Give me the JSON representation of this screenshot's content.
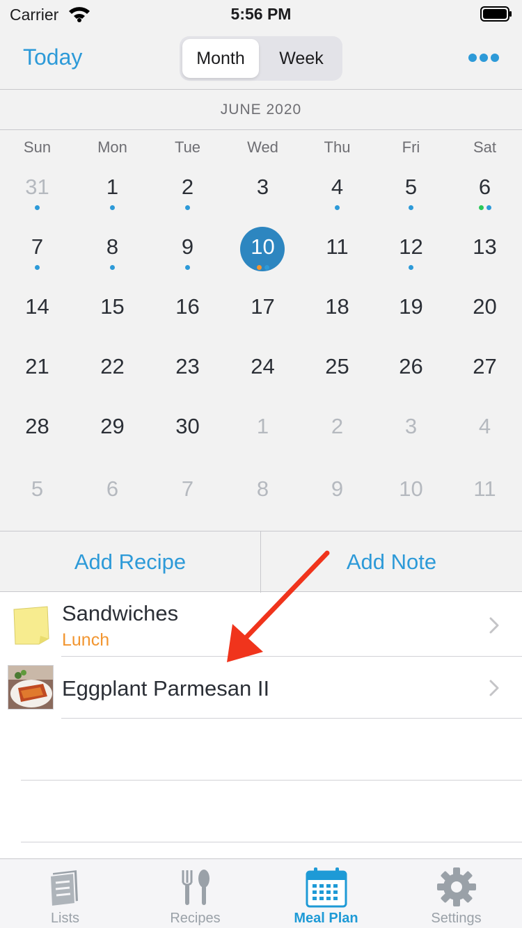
{
  "status_bar": {
    "carrier": "Carrier",
    "time": "5:56 PM"
  },
  "nav": {
    "today_label": "Today",
    "segments": [
      "Month",
      "Week"
    ],
    "selected_segment": "Month",
    "more_icon": "more-icon"
  },
  "calendar": {
    "month_title": "JUNE 2020",
    "weekdays": [
      "Sun",
      "Mon",
      "Tue",
      "Wed",
      "Thu",
      "Fri",
      "Sat"
    ],
    "selected_day": "10",
    "weeks": [
      [
        {
          "d": "31",
          "dim": true,
          "dots": [
            "#2d9ad8"
          ]
        },
        {
          "d": "1",
          "dots": [
            "#2d9ad8"
          ]
        },
        {
          "d": "2",
          "dots": [
            "#2d9ad8"
          ]
        },
        {
          "d": "3",
          "dots": []
        },
        {
          "d": "4",
          "dots": [
            "#2d9ad8"
          ]
        },
        {
          "d": "5",
          "dots": [
            "#2d9ad8"
          ]
        },
        {
          "d": "6",
          "dots": [
            "#2ac85a",
            "#2d9ad8"
          ]
        }
      ],
      [
        {
          "d": "7",
          "dots": [
            "#2d9ad8"
          ]
        },
        {
          "d": "8",
          "dots": [
            "#2d9ad8"
          ]
        },
        {
          "d": "9",
          "dots": [
            "#2d9ad8"
          ]
        },
        {
          "d": "10",
          "today": true,
          "dots": [
            "#f2952f",
            "#2d9ad8"
          ]
        },
        {
          "d": "11",
          "dots": []
        },
        {
          "d": "12",
          "dots": [
            "#2d9ad8"
          ]
        },
        {
          "d": "13",
          "dots": []
        }
      ],
      [
        {
          "d": "14",
          "dots": []
        },
        {
          "d": "15",
          "dots": []
        },
        {
          "d": "16",
          "dots": []
        },
        {
          "d": "17",
          "dots": []
        },
        {
          "d": "18",
          "dots": []
        },
        {
          "d": "19",
          "dots": []
        },
        {
          "d": "20",
          "dots": []
        }
      ],
      [
        {
          "d": "21",
          "dots": []
        },
        {
          "d": "22",
          "dots": []
        },
        {
          "d": "23",
          "dots": []
        },
        {
          "d": "24",
          "dots": []
        },
        {
          "d": "25",
          "dots": []
        },
        {
          "d": "26",
          "dots": []
        },
        {
          "d": "27",
          "dots": []
        }
      ],
      [
        {
          "d": "28",
          "dots": []
        },
        {
          "d": "29",
          "dots": []
        },
        {
          "d": "30",
          "dots": []
        },
        {
          "d": "1",
          "dim": true,
          "dots": []
        },
        {
          "d": "2",
          "dim": true,
          "dots": []
        },
        {
          "d": "3",
          "dim": true,
          "dots": []
        },
        {
          "d": "4",
          "dim": true,
          "dots": []
        }
      ],
      [
        {
          "d": "5",
          "dim": true,
          "dots": []
        },
        {
          "d": "6",
          "dim": true,
          "dots": []
        },
        {
          "d": "7",
          "dim": true,
          "dots": []
        },
        {
          "d": "8",
          "dim": true,
          "dots": []
        },
        {
          "d": "9",
          "dim": true,
          "dots": []
        },
        {
          "d": "10",
          "dim": true,
          "dots": []
        },
        {
          "d": "11",
          "dim": true,
          "dots": []
        }
      ]
    ]
  },
  "actions": {
    "add_recipe": "Add Recipe",
    "add_note": "Add Note"
  },
  "meals": [
    {
      "title": "Sandwiches",
      "subtitle": "Lunch",
      "icon": "note-icon"
    },
    {
      "title": "Eggplant Parmesan II",
      "icon": "recipe-photo"
    }
  ],
  "tabs": [
    {
      "label": "Lists",
      "icon": "lists-icon"
    },
    {
      "label": "Recipes",
      "icon": "recipes-icon"
    },
    {
      "label": "Meal Plan",
      "icon": "calendar-icon",
      "active": true
    },
    {
      "label": "Settings",
      "icon": "gear-icon"
    }
  ],
  "colors": {
    "accent": "#2d9ad8",
    "today_fill": "#2d86c0",
    "subtitle": "#f2952f",
    "annotation_arrow": "#f0341c"
  }
}
